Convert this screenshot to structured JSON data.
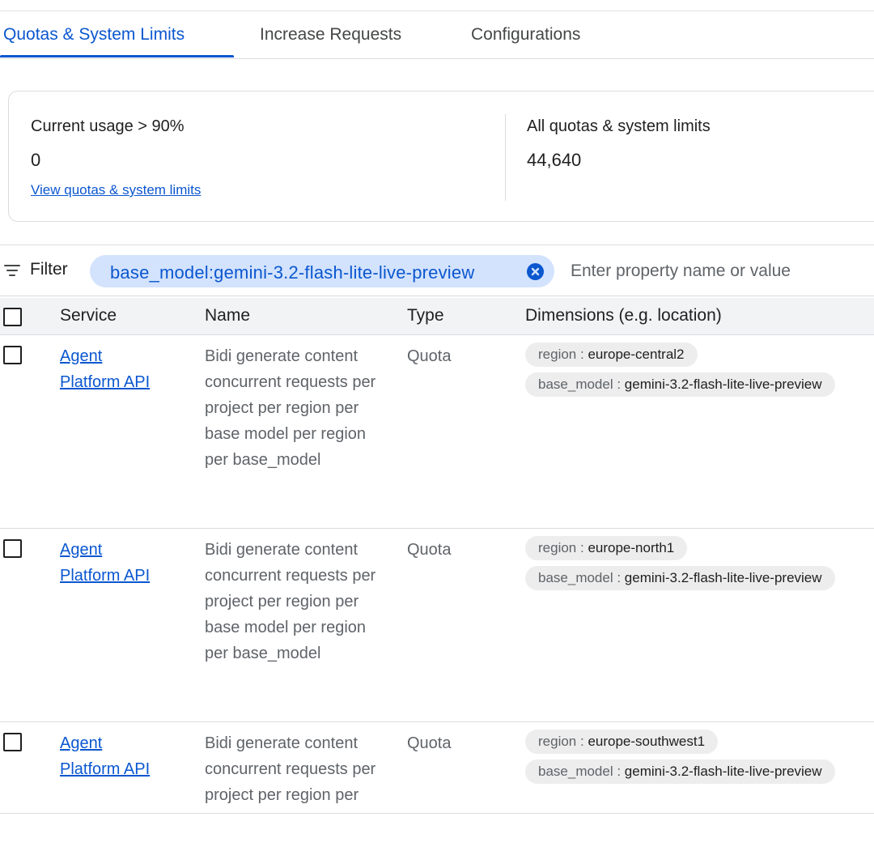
{
  "tabs": [
    {
      "label": "Quotas & System Limits",
      "active": true
    },
    {
      "label": "Increase Requests",
      "active": false
    },
    {
      "label": "Configurations",
      "active": false
    }
  ],
  "summary": {
    "current_usage": {
      "title": "Current usage > 90%",
      "value": "0",
      "link": "View quotas & system limits"
    },
    "all_quotas": {
      "title": "All quotas & system limits",
      "value": "44,640"
    }
  },
  "filter": {
    "icon": "filter-list-icon",
    "label": "Filter",
    "chip": "base_model:gemini-3.2-flash-lite-live-preview",
    "chip_close_icon": "cancel-circle-icon",
    "placeholder": "Enter property name or value"
  },
  "table": {
    "columns": [
      "Service",
      "Name",
      "Type",
      "Dimensions (e.g. location)"
    ],
    "rows": [
      {
        "service_line1": "Agent",
        "service_line2": "Platform API",
        "name": "Bidi generate content concurrent requests per project per region per base model per region per base_model",
        "type": "Quota",
        "dimensions": [
          {
            "key": "region",
            "sep": " : ",
            "value": "europe-central2"
          },
          {
            "key": "base_model",
            "sep": " : ",
            "value": "gemini-3.2-flash-lite-live-preview"
          }
        ]
      },
      {
        "service_line1": "Agent",
        "service_line2": "Platform API",
        "name": "Bidi generate content concurrent requests per project per region per base model per region per base_model",
        "type": "Quota",
        "dimensions": [
          {
            "key": "region",
            "sep": " : ",
            "value": "europe-north1"
          },
          {
            "key": "base_model",
            "sep": " : ",
            "value": "gemini-3.2-flash-lite-live-preview"
          }
        ]
      },
      {
        "service_line1": "Agent",
        "service_line2": "Platform API",
        "name": "Bidi generate content concurrent requests per project per region per base model per region per base_model",
        "type": "Quota",
        "dimensions": [
          {
            "key": "region",
            "sep": " : ",
            "value": "europe-southwest1"
          },
          {
            "key": "base_model",
            "sep": " : ",
            "value": "gemini-3.2-flash-lite-live-preview"
          }
        ]
      }
    ]
  },
  "colors": {
    "accent": "#0b57d0",
    "chip_bg": "#d3e3fd",
    "dim_chip_bg": "#ededed",
    "header_bg": "#f1f3f4",
    "muted_text": "#5f6368",
    "border": "#dadce0"
  }
}
